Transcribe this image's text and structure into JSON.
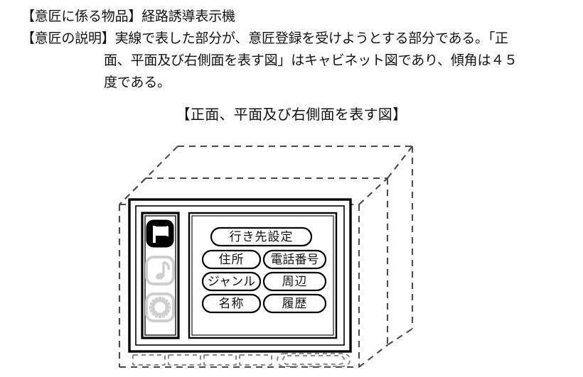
{
  "document": {
    "lines": [
      "【意匠に係る物品】経路誘導表示機",
      "【意匠の説明】実線で表した部分が、意匠登録を受けようとする部分である。「正",
      "面、平面及び右側面を表す図」はキャビネット図であり、傾角は４５",
      "度である。"
    ],
    "line1": "【意匠に係る物品】経路誘導表示機",
    "line2": "【意匠の説明】実線で表した部分が、意匠登録を受けようとする部分である。「正",
    "line3": "面、平面及び右側面を表す図」はキャビネット図であり、傾角は４５",
    "line4": "度である。",
    "figure_caption": "【正面、平面及び右側面を表す図】"
  },
  "device": {
    "sidebar": {
      "icons": [
        {
          "name": "flag-icon",
          "label": "行き先",
          "state": "active",
          "color": "#000000"
        },
        {
          "name": "music-note-icon",
          "label": "音楽",
          "state": "inactive",
          "color": "#cccccc"
        },
        {
          "name": "gear-icon",
          "label": "設定",
          "state": "inactive",
          "color": "#cccccc"
        }
      ]
    },
    "screen": {
      "primary_button": "行き先設定",
      "buttons": [
        {
          "label": "住所"
        },
        {
          "label": "電話番号"
        },
        {
          "label": "ジャンル"
        },
        {
          "label": "周辺"
        },
        {
          "label": "名称"
        },
        {
          "label": "履歴"
        }
      ],
      "rows": [
        [
          "住所",
          "電話番号"
        ],
        [
          "ジャンル",
          "周辺"
        ],
        [
          "名称",
          "履歴"
        ]
      ]
    },
    "bottom_controls": [
      {
        "name": "bottom-key-1",
        "shape": "rect"
      },
      {
        "name": "bottom-key-2",
        "shape": "rect"
      },
      {
        "name": "bottom-key-3",
        "shape": "rect"
      },
      {
        "name": "bottom-key-4",
        "shape": "rect"
      },
      {
        "name": "bottom-dial",
        "shape": "pill"
      }
    ]
  },
  "colors": {
    "line": "#000000",
    "dashed": "#4a4a4a",
    "inactive_icon": "#cfcfcf",
    "text": "#111111",
    "background": "#ffffff"
  }
}
